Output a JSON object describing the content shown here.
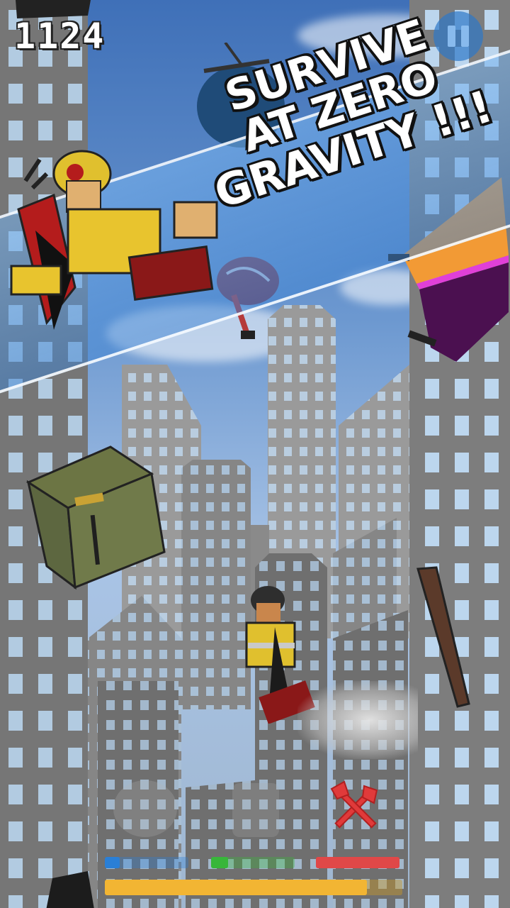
{
  "game": {
    "score": "1124",
    "promo": {
      "line1": "SURVIVE",
      "line2": "AT ZERO",
      "line3": "GRAVITY !!!"
    }
  },
  "hud": {
    "pause_icon": "pause-icon",
    "tool_icon": "crossed-axes-icon",
    "meters": [
      {
        "name": "blue-meter",
        "color": "#2a7fd6",
        "level": 0.18
      },
      {
        "name": "green-meter",
        "color": "#38b63a",
        "level": 0.2
      },
      {
        "name": "red-meter",
        "color": "#e04848",
        "level": 1.0
      }
    ],
    "fuel_level": 0.88,
    "fuel_color": "#f2b533"
  }
}
